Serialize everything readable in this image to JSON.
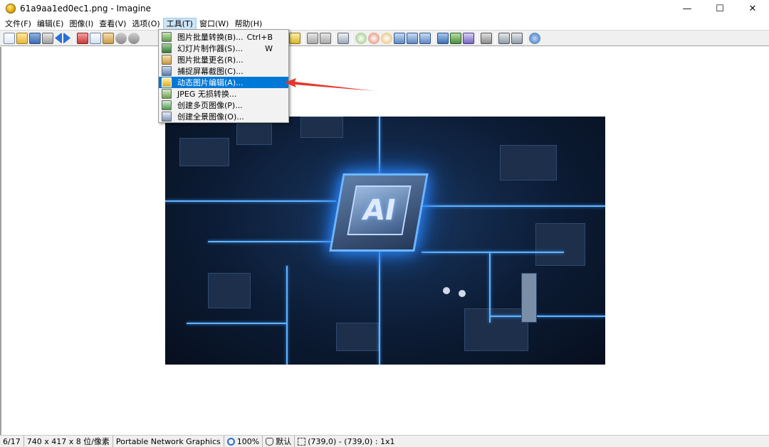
{
  "window": {
    "title": "61a9aa1ed0ec1.png - Imagine",
    "app_icon": "imagine-app-icon",
    "controls": {
      "minimize": "—",
      "maximize": "☐",
      "close": "✕"
    }
  },
  "menubar": {
    "items": [
      {
        "label": "文件(F)"
      },
      {
        "label": "编辑(E)"
      },
      {
        "label": "图像(I)"
      },
      {
        "label": "查看(V)"
      },
      {
        "label": "选项(O)"
      },
      {
        "label": "工具(T)",
        "active": true
      },
      {
        "label": "窗口(W)"
      },
      {
        "label": "帮助(H)"
      }
    ]
  },
  "tools_menu": {
    "items": [
      {
        "label": "图片批量转换(B)...",
        "shortcut": "Ctrl+B",
        "icon": "batch-convert-icon"
      },
      {
        "label": "幻灯片制作器(S)...",
        "shortcut": "W",
        "icon": "slideshow-icon"
      },
      {
        "label": "图片批量更名(R)...",
        "shortcut": "",
        "icon": "batch-rename-icon"
      },
      {
        "label": "捕捉屏幕截图(C)...",
        "shortcut": "",
        "icon": "screen-capture-icon"
      },
      {
        "label": "动态图片编辑(A)...",
        "shortcut": "",
        "icon": "animation-edit-icon",
        "highlighted": true
      },
      {
        "label": "JPEG 无损转换...",
        "shortcut": "",
        "icon": "jpeg-lossless-icon"
      },
      {
        "label": "创建多页图像(P)...",
        "shortcut": "",
        "icon": "multipage-icon"
      },
      {
        "label": "创建全景图像(O)...",
        "shortcut": "",
        "icon": "panorama-icon"
      }
    ]
  },
  "image": {
    "chip_label": "AI"
  },
  "statusbar": {
    "index": "6/17",
    "dimensions": "740 x 417 x 8 位/像素",
    "format": "Portable Network Graphics",
    "zoom": "100%",
    "mode": "默认",
    "selection": "(739,0) - (739,0) : 1x1"
  },
  "colors": {
    "menu_highlight": "#0078d7",
    "annotation_arrow": "#e8362b"
  }
}
